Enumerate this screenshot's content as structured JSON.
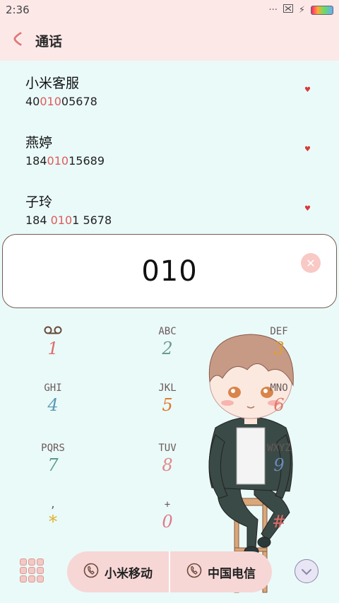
{
  "status": {
    "time": "2:36"
  },
  "header": {
    "title": "通话"
  },
  "contacts": [
    {
      "name": "小米客服",
      "number_pre": "40",
      "number_hl": "010",
      "number_post": "05678"
    },
    {
      "name": "燕婷",
      "number_pre": "184",
      "number_hl": "010",
      "number_post": "15689"
    },
    {
      "name": "子玲",
      "number_pre": "184 ",
      "number_hl": "010",
      "number_post": "1 5678"
    }
  ],
  "dial": {
    "number": "010"
  },
  "keypad": [
    {
      "sub": "",
      "digit": "1"
    },
    {
      "sub": "ABC",
      "digit": "2"
    },
    {
      "sub": "DEF",
      "digit": "3"
    },
    {
      "sub": "GHI",
      "digit": "4"
    },
    {
      "sub": "JKL",
      "digit": "5"
    },
    {
      "sub": "MNO",
      "digit": "6"
    },
    {
      "sub": "PQRS",
      "digit": "7"
    },
    {
      "sub": "TUV",
      "digit": "8"
    },
    {
      "sub": "WXYZ",
      "digit": "9"
    },
    {
      "sub": ",",
      "digit": "*"
    },
    {
      "sub": "+",
      "digit": "0"
    },
    {
      "sub": "",
      "digit": "#"
    }
  ],
  "sims": [
    {
      "label": "小米移动"
    },
    {
      "label": "中国电信"
    }
  ],
  "colors": {
    "header_bg": "#fde8e8",
    "page_bg": "#eafaf9",
    "highlight": "#e05a5a",
    "sim_bg": "#f7d6d6",
    "digit_colors": [
      "#e06a6a",
      "#6a9a8e",
      "#e0a030",
      "#5a9ab8",
      "#e07a30",
      "#e07a6a",
      "#5a9a8a",
      "#e08a8a",
      "#6a8ab8",
      "#e0b030",
      "#e07a8a",
      "#e06a6a"
    ]
  },
  "icons": {
    "back": "chevron-left-icon",
    "voicemail": "voicemail-icon",
    "clear": "close-icon",
    "dialpad": "dialpad-grid-icon",
    "sim": "phone-sim-icon",
    "collapse": "chevron-down-icon"
  }
}
